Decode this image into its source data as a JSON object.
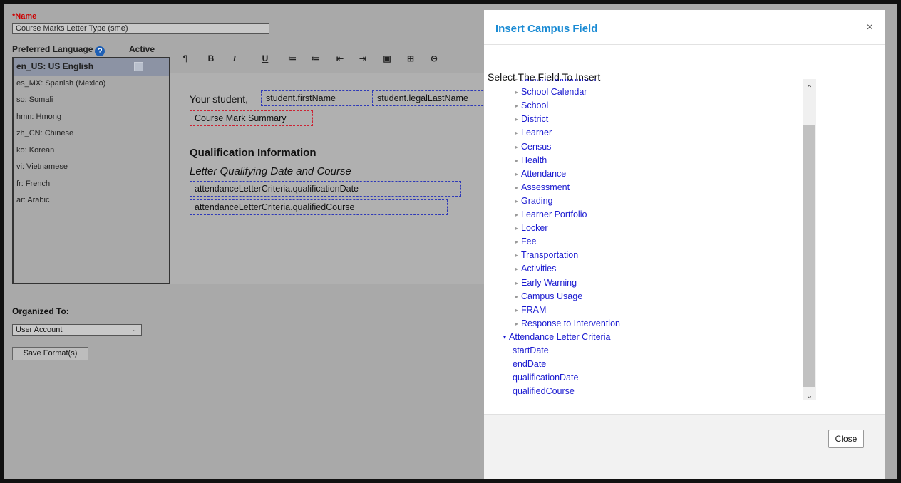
{
  "form": {
    "name_label": "*Name",
    "name_value": "Course Marks Letter Type (sme)"
  },
  "languages": {
    "header": "Preferred Language",
    "help_icon": "?",
    "active_label": "Active",
    "items": [
      {
        "label": "en_US: US English"
      },
      {
        "label": "es_MX: Spanish (Mexico)"
      },
      {
        "label": "so: Somali"
      },
      {
        "label": "hmn: Hmong"
      },
      {
        "label": "zh_CN: Chinese"
      },
      {
        "label": "ko: Korean"
      },
      {
        "label": "vi: Vietnamese"
      },
      {
        "label": "fr: French"
      },
      {
        "label": "ar: Arabic"
      }
    ]
  },
  "toolbar": {
    "paragraph": "¶",
    "bold": "B",
    "italic": "I",
    "underline": "U",
    "bullet_list": "≔",
    "numbered_list": "≔",
    "outdent": "⇤",
    "indent": "⇥",
    "image": "▣",
    "table": "⊞",
    "link": "⊝"
  },
  "editor": {
    "greeting": "Your student,",
    "field_first_name": "student.firstName",
    "field_last_name": "student.legalLastName",
    "field_course_summary": "Course Mark Summary",
    "qual_heading": "Qualification Information",
    "qual_subheading": "Letter Qualifying Date and Course",
    "field_qual_date": "attendanceLetterCriteria.qualificationDate",
    "field_qual_course": "attendanceLetterCriteria.qualifiedCourse"
  },
  "organized": {
    "label": "Organized To:",
    "selected": "User Account",
    "save_label": "Save Format(s)"
  },
  "modal": {
    "title": "Insert Campus Field",
    "close_x": "×",
    "select_label": "Select The Field To Insert",
    "tree": [
      "School Boundaries",
      "School Calendar",
      "School",
      "District",
      "Learner",
      "Census",
      "Health",
      "Attendance",
      "Assessment",
      "Grading",
      "Learner Portfolio",
      "Locker",
      "Fee",
      "Transportation",
      "Activities",
      "Early Warning",
      "Campus Usage",
      "FRAM",
      "Response to Intervention"
    ],
    "open_group": "Attendance Letter Criteria",
    "open_children": [
      "startDate",
      "endDate",
      "qualificationDate",
      "qualifiedCourse"
    ],
    "close_button": "Close"
  }
}
